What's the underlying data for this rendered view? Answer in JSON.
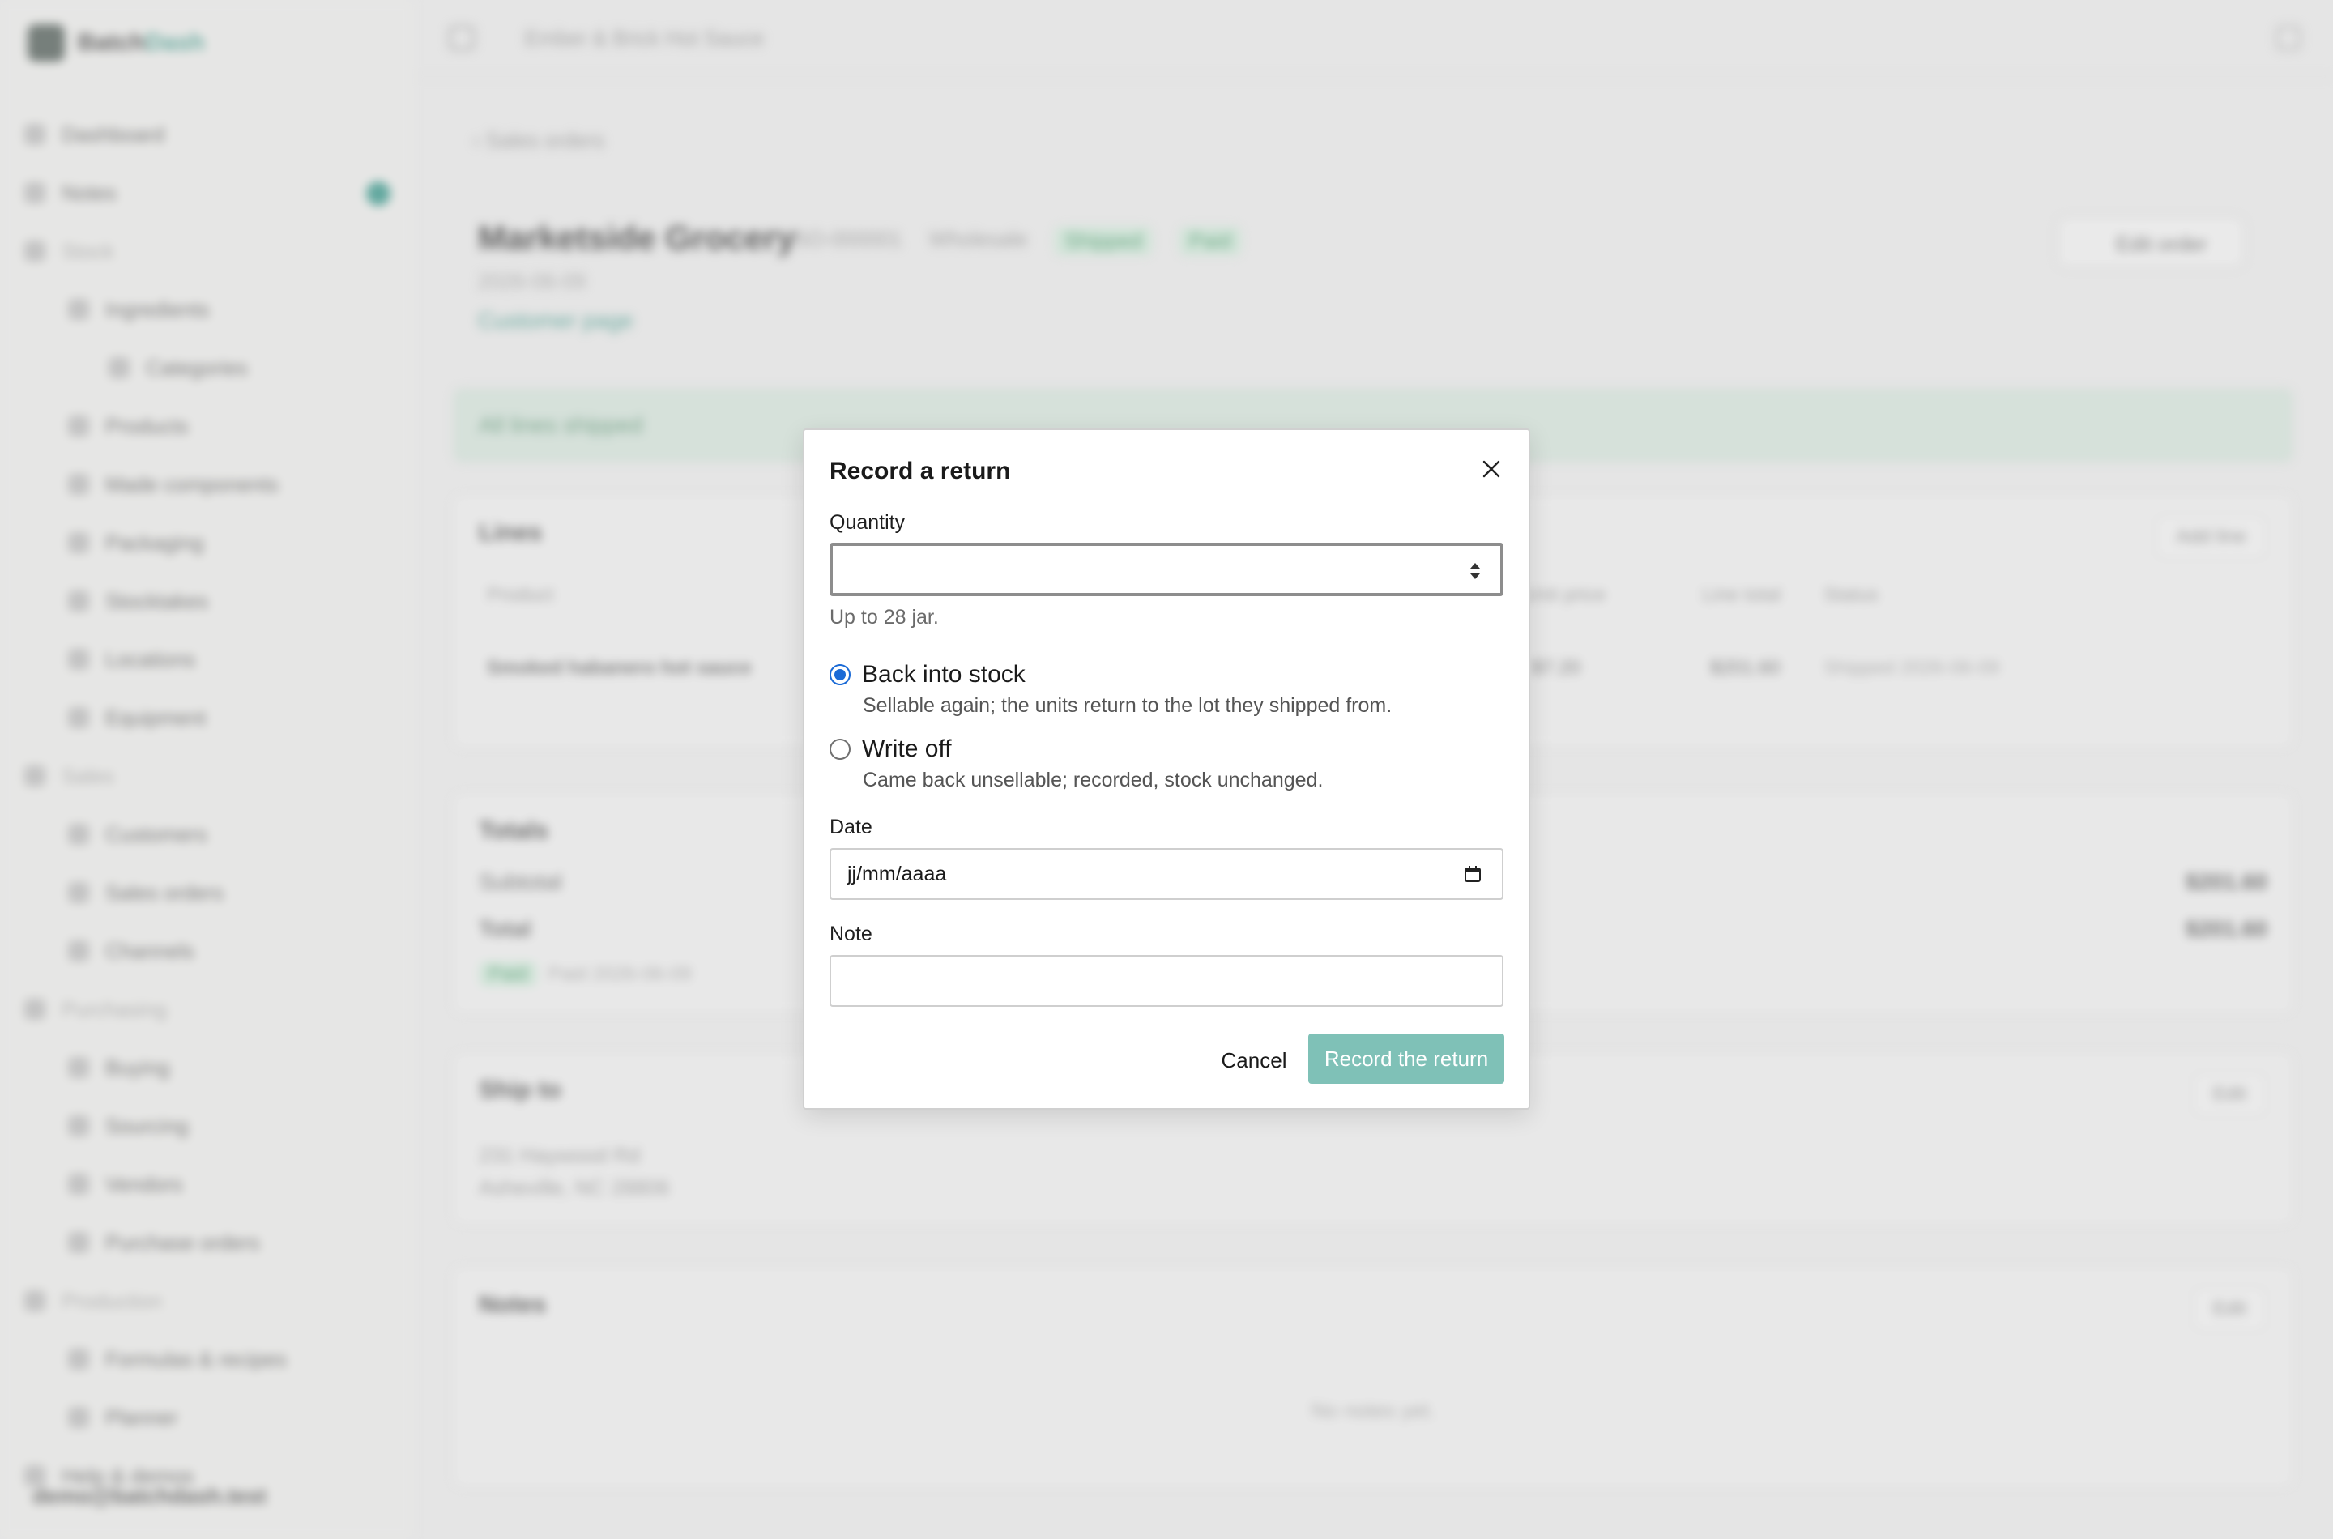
{
  "app": {
    "brand_prefix": "Batch",
    "brand_suffix": "Dash",
    "breadcrumb": "Ember & Brick Hot Sauce",
    "user_email": "demo@batchdash.test"
  },
  "sidebar": {
    "items": [
      {
        "label": "Dashboard",
        "level": 0
      },
      {
        "label": "Notes",
        "level": 0
      },
      {
        "label": "Stock",
        "level": 0,
        "group": true
      },
      {
        "label": "Ingredients",
        "level": 1
      },
      {
        "label": "Categories",
        "level": 2
      },
      {
        "label": "Products",
        "level": 1
      },
      {
        "label": "Made components",
        "level": 1
      },
      {
        "label": "Packaging",
        "level": 1
      },
      {
        "label": "Stocktakes",
        "level": 1
      },
      {
        "label": "Locations",
        "level": 1
      },
      {
        "label": "Equipment",
        "level": 1
      },
      {
        "label": "Sales",
        "level": 0,
        "group": true
      },
      {
        "label": "Customers",
        "level": 1
      },
      {
        "label": "Sales orders",
        "level": 1,
        "active": true
      },
      {
        "label": "Channels",
        "level": 1
      },
      {
        "label": "Purchasing",
        "level": 0,
        "group": true
      },
      {
        "label": "Buying",
        "level": 1
      },
      {
        "label": "Sourcing",
        "level": 1
      },
      {
        "label": "Vendors",
        "level": 1
      },
      {
        "label": "Purchase orders",
        "level": 1
      },
      {
        "label": "Production",
        "level": 0,
        "group": true
      },
      {
        "label": "Formulas & recipes",
        "level": 1
      },
      {
        "label": "Planner",
        "level": 1
      },
      {
        "label": "Help & demos",
        "level": 0
      }
    ]
  },
  "order": {
    "back_label": "Sales orders",
    "customer": "Marketside Grocery",
    "order_number": "SO-000001",
    "channel": "Wholesale",
    "status_shipped": "Shipped",
    "status_paid": "Paid",
    "date": "2026-06-09",
    "customer_link": "Customer page",
    "edit_label": "Edit order",
    "banner": "All lines shipped"
  },
  "lines": {
    "title": "Lines",
    "add_label": "Add line",
    "headers": {
      "product": "Product",
      "unit_price": "Unit price",
      "line_total": "Line total",
      "status": "Status"
    },
    "row": {
      "product": "Smoked habanero hot sauce",
      "unit_price": "$7.20",
      "line_total": "$201.60",
      "status": "Shipped 2026-06-09"
    }
  },
  "totals": {
    "title": "Totals",
    "subtotal_label": "Subtotal",
    "subtotal": "$201.60",
    "total_label": "Total",
    "total": "$201.60",
    "paid_tag": "Paid",
    "paid_text": "Paid 2026-06-09"
  },
  "ship_to": {
    "title": "Ship to",
    "edit_label": "Edit",
    "line1": "231 Haywood Rd",
    "line2": "Asheville, NC 28806"
  },
  "notes": {
    "title": "Notes",
    "edit_label": "Edit",
    "empty": "No notes yet."
  },
  "modal": {
    "title": "Record a return",
    "quantity_label": "Quantity",
    "quantity_value": "",
    "quantity_hint": "Up to 28 jar.",
    "options": [
      {
        "label": "Back into stock",
        "description": "Sellable again; the units return to the lot they shipped from.",
        "selected": true
      },
      {
        "label": "Write off",
        "description": "Came back unsellable; recorded, stock unchanged.",
        "selected": false
      }
    ],
    "date_label": "Date",
    "date_placeholder": "jj/mm/aaaa",
    "note_label": "Note",
    "note_value": "",
    "cancel_label": "Cancel",
    "submit_label": "Record the return",
    "submit_color": "#7fc1b7",
    "radio_accent": "#1a6ad6"
  }
}
